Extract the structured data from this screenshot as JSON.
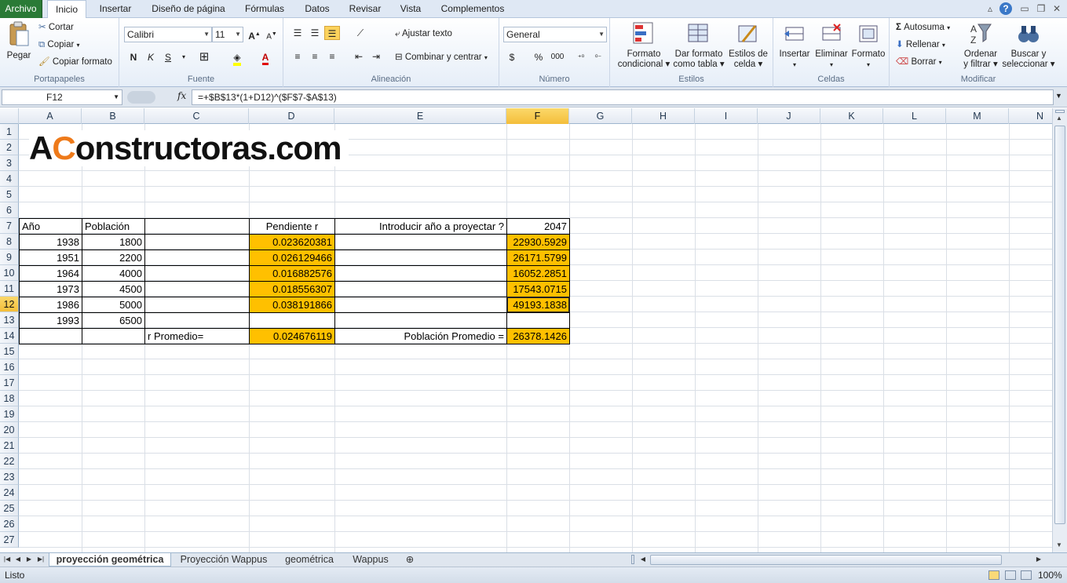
{
  "ribbon_tabs": [
    "Archivo",
    "Inicio",
    "Insertar",
    "Diseño de página",
    "Fórmulas",
    "Datos",
    "Revisar",
    "Vista",
    "Complementos"
  ],
  "clipboard": {
    "pegar": "Pegar",
    "cortar": "Cortar",
    "copiar": "Copiar",
    "copiar_formato": "Copiar formato",
    "label": "Portapapeles"
  },
  "fuente": {
    "font": "Calibri",
    "size": "11",
    "label": "Fuente",
    "bold": "N",
    "italic": "K",
    "underline": "S"
  },
  "alineacion": {
    "ajustar": "Ajustar texto",
    "combinar": "Combinar y centrar",
    "label": "Alineación"
  },
  "numero": {
    "format": "General",
    "currency": "$",
    "percent": "%",
    "thousands": "000",
    "label": "Número"
  },
  "estilos": {
    "formato_cond_1": "Formato",
    "formato_cond_2": "condicional",
    "dar_formato_1": "Dar formato",
    "dar_formato_2": "como tabla",
    "estilos_celda_1": "Estilos de",
    "estilos_celda_2": "celda",
    "label": "Estilos"
  },
  "celdas": {
    "insertar": "Insertar",
    "eliminar": "Eliminar",
    "formato": "Formato",
    "label": "Celdas"
  },
  "modificar": {
    "autosuma": "Autosuma",
    "rellenar": "Rellenar",
    "borrar": "Borrar",
    "ordenar_1": "Ordenar",
    "ordenar_2": "y filtrar",
    "buscar_1": "Buscar y",
    "buscar_2": "seleccionar",
    "label": "Modificar"
  },
  "formula_bar": {
    "name_box": "F12",
    "fx": "fx",
    "formula": "=+$B$13*(1+D12)^($F$7-$A$13)"
  },
  "columns": [
    "A",
    "B",
    "C",
    "D",
    "E",
    "F",
    "G",
    "H",
    "I",
    "J",
    "K",
    "L",
    "M",
    "N"
  ],
  "rows": [
    "1",
    "2",
    "3",
    "4",
    "5",
    "6",
    "7",
    "8",
    "9",
    "10",
    "11",
    "12",
    "13",
    "14",
    "15",
    "16",
    "17",
    "18",
    "19",
    "20",
    "21",
    "22",
    "23",
    "24",
    "25",
    "26",
    "27"
  ],
  "logo": {
    "before": "A",
    "o": "C",
    "after": "onstructoras.com"
  },
  "table": {
    "h_ano": "Año",
    "h_poblacion": "Población",
    "h_pendiente": "Pendiente r",
    "h_introducir": "Introducir año a proyectar  ?",
    "h_year": "2047",
    "anos": [
      "1938",
      "1951",
      "1964",
      "1973",
      "1986",
      "1993"
    ],
    "poblacion": [
      "1800",
      "2200",
      "4000",
      "4500",
      "5000",
      "6500"
    ],
    "pendiente": [
      "0.023620381",
      "0.026129466",
      "0.016882576",
      "0.018556307",
      "0.038191866"
    ],
    "proyeccion": [
      "22930.5929",
      "26171.5799",
      "16052.2851",
      "17543.0715",
      "49193.1838"
    ],
    "r_promedio_label": "r Promedio=",
    "r_promedio": "0.024676119",
    "pob_promedio_label": "Población Promedio =",
    "pob_promedio": "26378.1426"
  },
  "sheets": [
    "proyección geométrica",
    "Proyección Wappus",
    "geométrica",
    "Wappus"
  ],
  "status": {
    "ready": "Listo",
    "zoom": "100%"
  },
  "colors": {
    "highlight": "#ffc000",
    "file_tab": "#2a7a36",
    "logo_accent": "#ee7a1a"
  }
}
